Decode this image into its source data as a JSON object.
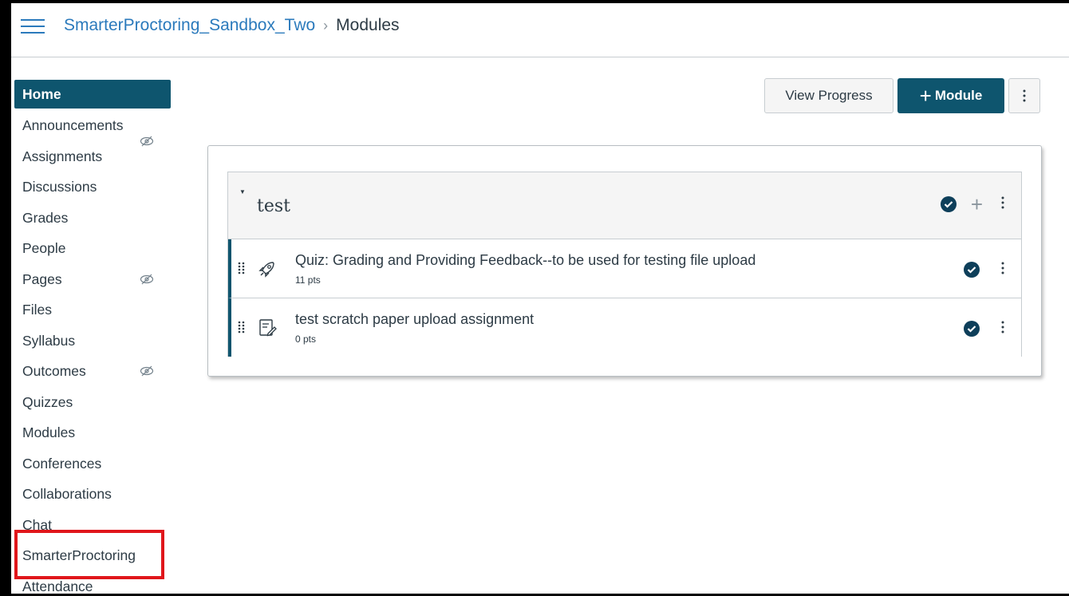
{
  "header": {
    "course_name": "SmarterProctoring_Sandbox_Two",
    "separator": "›",
    "current_page": "Modules"
  },
  "sidebar": {
    "items": [
      {
        "label": "Home",
        "active": true
      },
      {
        "label": "Announcements"
      },
      {
        "label": "Assignments",
        "hidden_icon": "eye-slash-icon"
      },
      {
        "label": "Discussions"
      },
      {
        "label": "Grades"
      },
      {
        "label": "People"
      },
      {
        "label": "Pages",
        "hidden_icon": "eye-slash-icon"
      },
      {
        "label": "Files"
      },
      {
        "label": "Syllabus"
      },
      {
        "label": "Outcomes",
        "hidden_icon": "eye-slash-icon"
      },
      {
        "label": "Quizzes"
      },
      {
        "label": "Modules"
      },
      {
        "label": "Conferences"
      },
      {
        "label": "Collaborations"
      },
      {
        "label": "Chat"
      },
      {
        "label": "SmarterProctoring",
        "highlighted": true
      },
      {
        "label": "Attendance"
      }
    ]
  },
  "toolbar": {
    "view_progress_label": "View Progress",
    "add_module_label": "Module",
    "add_module_icon": "plus-icon",
    "more_icon": "kebab-icon"
  },
  "module": {
    "title": "test",
    "published": true,
    "items": [
      {
        "type": "quiz",
        "icon": "rocket-icon",
        "title": "Quiz: Grading and Providing Feedback--to be used for testing file upload",
        "points": "11 pts",
        "published": true
      },
      {
        "type": "assignment",
        "icon": "assignment-icon",
        "title": "test scratch paper upload assignment",
        "points": "0 pts",
        "published": true
      }
    ]
  },
  "colors": {
    "brand_dark": "#0e556e",
    "link": "#2b7abc",
    "highlight_border": "#e0161b",
    "published_check": "#0e3f5a"
  }
}
